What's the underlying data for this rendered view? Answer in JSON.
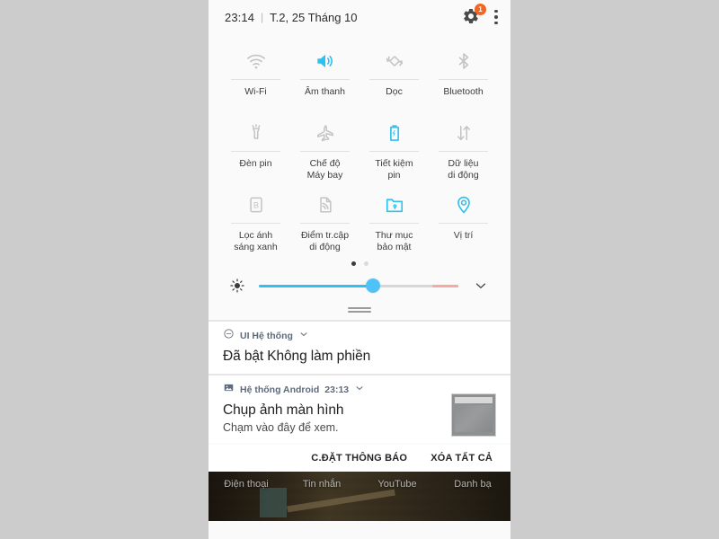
{
  "statusbar": {
    "time": "23:14",
    "separator": "|",
    "date": "T.2, 25 Tháng 10",
    "gear_badge_count": "1"
  },
  "quick_settings": {
    "accent_color": "#2ec0f0",
    "inactive_color": "#c4c4c4",
    "rows": [
      [
        {
          "label": "Wi-Fi",
          "icon": "wifi-icon",
          "active": false
        },
        {
          "label": "Âm thanh",
          "icon": "sound-icon",
          "active": true
        },
        {
          "label": "Dọc",
          "icon": "rotation-icon",
          "active": false
        },
        {
          "label": "Bluetooth",
          "icon": "bluetooth-icon",
          "active": false
        }
      ],
      [
        {
          "label": "Đèn pin",
          "icon": "flashlight-icon",
          "active": false
        },
        {
          "label": "Chế độ\nMáy bay",
          "icon": "airplane-icon",
          "active": false
        },
        {
          "label": "Tiết kiệm\npin",
          "icon": "battery-saver-icon",
          "active": true
        },
        {
          "label": "Dữ liệu\ndi động",
          "icon": "mobile-data-icon",
          "active": false
        }
      ],
      [
        {
          "label": "Lọc ánh\nsáng xanh",
          "icon": "blue-light-filter-icon",
          "active": false
        },
        {
          "label": "Điểm tr.cập\ndi động",
          "icon": "hotspot-icon",
          "active": false
        },
        {
          "label": "Thư mục\nbảo mật",
          "icon": "secure-folder-icon",
          "active": true
        },
        {
          "label": "Vị trí",
          "icon": "location-pin-icon",
          "active": true
        }
      ]
    ],
    "page_indicator": {
      "total": 2,
      "current": 1
    }
  },
  "brightness": {
    "icon": "brightness-icon",
    "value_percent": 57,
    "expand_icon": "chevron-down-icon"
  },
  "notifications": [
    {
      "app": "UI Hệ thống",
      "app_icon": "do-not-disturb-icon",
      "time": "",
      "title": "Đã bật Không làm phiền",
      "body": "",
      "has_thumbnail": false
    },
    {
      "app": "Hệ thống Android",
      "app_icon": "image-icon",
      "time": "23:13",
      "title": "Chụp ảnh màn hình",
      "body": "Chạm vào đây để xem.",
      "has_thumbnail": true
    }
  ],
  "actions": {
    "settings_label": "C.ĐẶT THÔNG BÁO",
    "clear_all_label": "XÓA TẤT CẢ"
  },
  "dock": {
    "items": [
      "Điện thoại",
      "Tin nhắn",
      "YouTube",
      "Danh bạ"
    ]
  }
}
